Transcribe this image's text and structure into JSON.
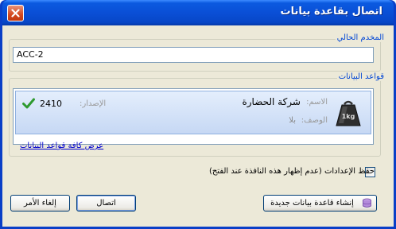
{
  "window": {
    "title": "اتصال بقاعدة بيانات"
  },
  "server_group": {
    "label": "المخدم الحالي",
    "value": "ACC-2"
  },
  "databases_group": {
    "label": "قواعد البيانات",
    "items": [
      {
        "name_label": "الاسم:",
        "name": "شركة الحضارة",
        "description_label": "الوصف:",
        "description": "بلا",
        "version_label": "الإصدار:",
        "version": "2410",
        "icon": "database-weight-icon",
        "status_icon": "check-icon"
      }
    ],
    "show_all_link": "عرض كافة قواعد البيانات"
  },
  "options": {
    "save_settings_label": "حفظ الإعدادات (عدم إظهار هذه النافذة عند الفتح)",
    "save_settings_checked": false
  },
  "buttons": {
    "create_new_db": "إنشاء قاعدة بيانات جديدة",
    "connect": "اتصال",
    "cancel": "إلغاء الأمر"
  },
  "colors": {
    "titlebar": "#0a4fd6",
    "dialog_bg": "#ece9d8",
    "group_label": "#0046d5",
    "selection": "#c6d8f4",
    "link": "#0000d0",
    "check": "#2e9a2e"
  }
}
